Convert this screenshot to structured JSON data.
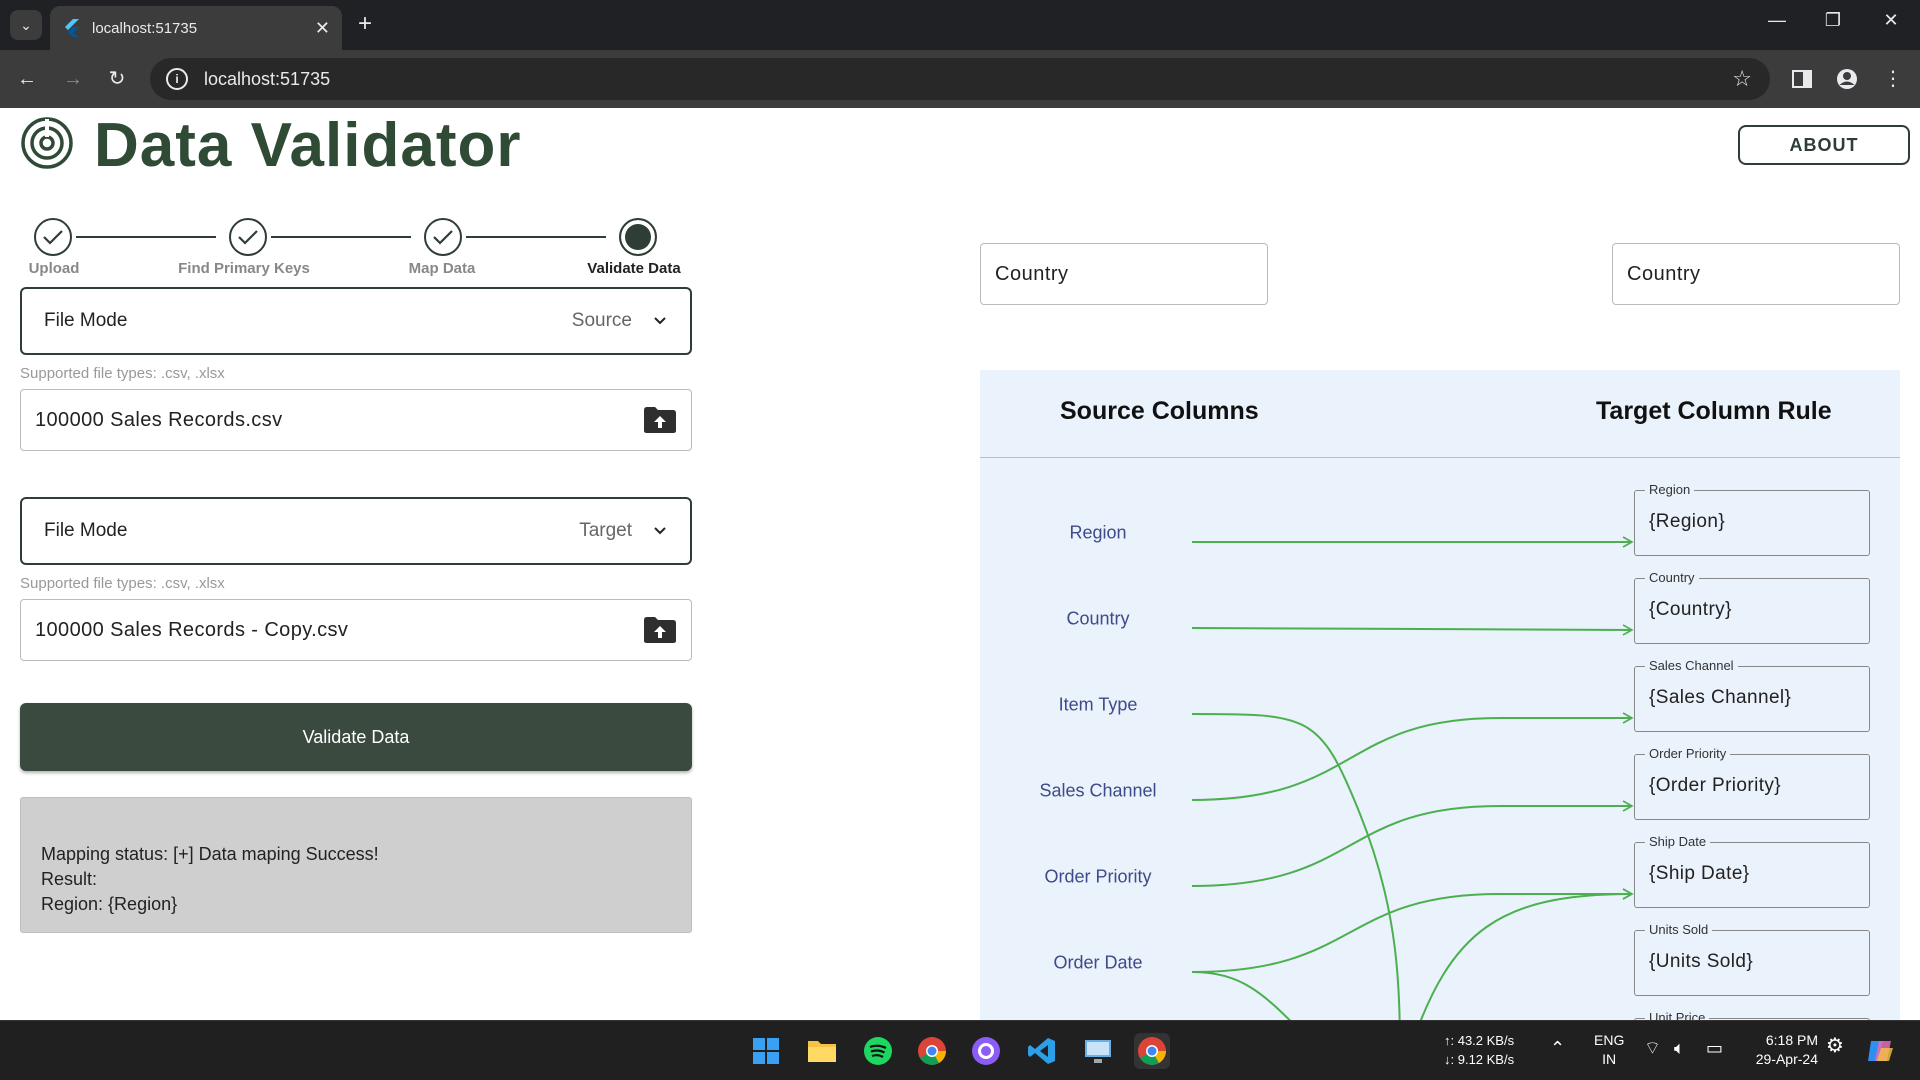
{
  "browser": {
    "tab_title": "localhost:51735",
    "url": "localhost:51735"
  },
  "app": {
    "title": "Data Validator",
    "about_label": "ABOUT"
  },
  "stepper": {
    "steps": [
      {
        "label": "Upload",
        "state": "done"
      },
      {
        "label": "Find Primary Keys",
        "state": "done"
      },
      {
        "label": "Map Data",
        "state": "done"
      },
      {
        "label": "Validate Data",
        "state": "active"
      }
    ]
  },
  "source": {
    "mode_label": "File Mode",
    "mode_value": "Source",
    "hint": "Supported file types: .csv, .xlsx",
    "file_name": "100000 Sales Records.csv"
  },
  "target": {
    "mode_label": "File Mode",
    "mode_value": "Target",
    "hint": "Supported file types: .csv, .xlsx",
    "file_name": "100000 Sales Records - Copy.csv"
  },
  "validate_label": "Validate Data",
  "status": {
    "line1": "Mapping status: [+] Data maping Success!",
    "line2": "Result:",
    "line3": "Region: {Region}"
  },
  "keys": {
    "source_key": "Country",
    "target_key": "Country"
  },
  "mapping": {
    "source_header": "Source Columns",
    "target_header": "Target Column Rule",
    "source_columns": [
      "Region",
      "Country",
      "Item Type",
      "Sales Channel",
      "Order Priority",
      "Order Date"
    ],
    "target_rules": [
      {
        "legend": "Region",
        "value": "{Region}"
      },
      {
        "legend": "Country",
        "value": "{Country}"
      },
      {
        "legend": "Sales Channel",
        "value": "{Sales Channel}"
      },
      {
        "legend": "Order Priority",
        "value": "{Order Priority}"
      },
      {
        "legend": "Ship Date",
        "value": "{Ship Date}"
      },
      {
        "legend": "Units Sold",
        "value": "{Units Sold}"
      },
      {
        "legend": "Unit Price",
        "value": ""
      }
    ],
    "line_color": "#4caf50"
  },
  "taskbar": {
    "net_up": "↑: 43.2 KB/s",
    "net_down": "↓: 9.12 KB/s",
    "lang1": "ENG",
    "lang2": "IN",
    "time": "6:18 PM",
    "date": "29-Apr-24"
  },
  "colors": {
    "accent": "#2f3e34",
    "title": "#2f4a35",
    "panel_bg": "#eaf2fb"
  }
}
